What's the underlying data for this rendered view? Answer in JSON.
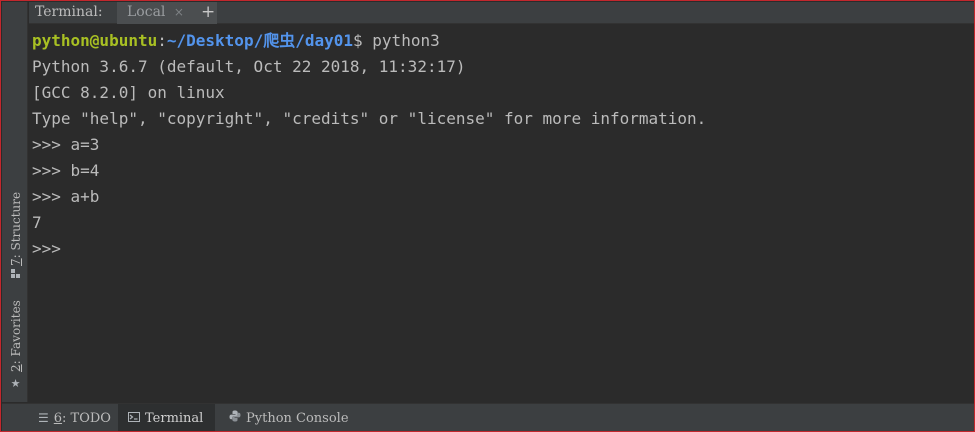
{
  "tabbar": {
    "terminal_label": "Terminal:",
    "local_tab": "Local",
    "close_glyph": "×",
    "new_tab_glyph": "+"
  },
  "sidebar": {
    "structure": {
      "mnemonic": "7",
      "label": ": Structure",
      "icon": "structure-icon"
    },
    "favorites": {
      "mnemonic": "2",
      "label": ": Favorites",
      "icon": "star-icon"
    }
  },
  "terminal": {
    "prompt": {
      "user_host": "python@ubuntu",
      "colon": ":",
      "path": "~/Desktop/爬虫/day01",
      "dollar": "$",
      "command": " python3"
    },
    "output": [
      "Python 3.6.7 (default, Oct 22 2018, 11:32:17)",
      "[GCC 8.2.0] on linux",
      "Type \"help\", \"copyright\", \"credits\" or \"license\" for more information.",
      ">>> a=3",
      ">>> b=4",
      ">>> a+b",
      "7",
      ">>> "
    ]
  },
  "bottombar": {
    "todo": {
      "mnemonic": "6",
      "label": ": TODO",
      "icon": "list-icon"
    },
    "terminal": {
      "label": "Terminal",
      "icon": "terminal-icon"
    },
    "python_console": {
      "label": "Python Console",
      "icon": "python-icon"
    }
  },
  "colors": {
    "background": "#2b2b2b",
    "panel": "#3c3f41",
    "prompt_user": "#a8c023",
    "prompt_path": "#5394ec",
    "border": "#c2272d"
  }
}
